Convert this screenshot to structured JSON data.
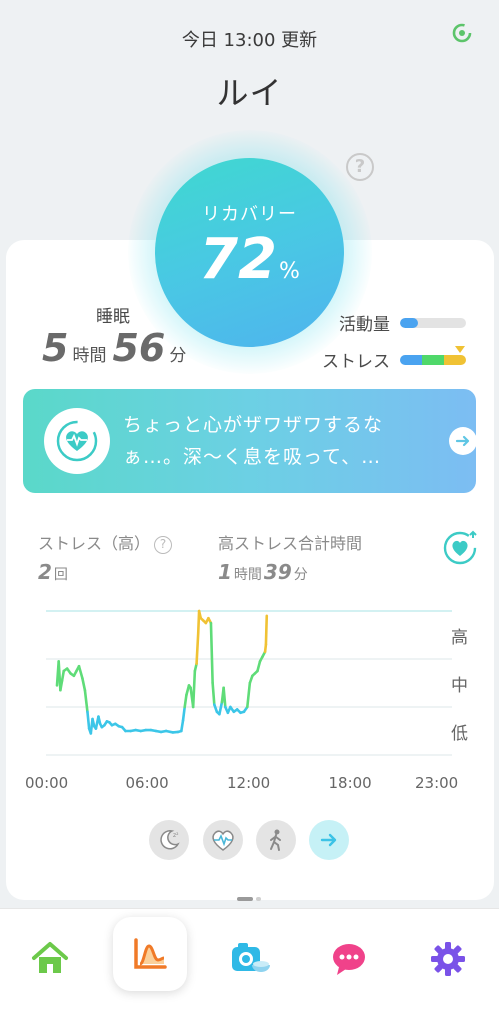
{
  "header": {
    "update_text": "今日 13:00 更新",
    "user_name": "ルイ"
  },
  "recovery": {
    "label": "リカバリー",
    "value": "72",
    "unit": "%"
  },
  "sleep": {
    "label": "睡眠",
    "hours": "5",
    "hours_unit": "時間",
    "minutes": "56",
    "minutes_unit": "分"
  },
  "activity": {
    "label": "活動量",
    "level": 0.28,
    "color": "#4aa3f0"
  },
  "stress_meter": {
    "label": "ストレス",
    "segments": [
      {
        "color": "#4aa3f0",
        "share": 0.33
      },
      {
        "color": "#4fd86a",
        "share": 0.33
      },
      {
        "color": "#f0c234",
        "share": 0.34
      }
    ],
    "marker_color": "#f0c234"
  },
  "message": {
    "text": "ちょっと心がザワザワするなぁ…。深〜く息を吸って、…"
  },
  "stress_stats": {
    "high_label": "ストレス（高）",
    "high_count": "2",
    "high_count_unit": "回",
    "total_label": "高ストレス合計時間",
    "total_hours": "1",
    "total_hours_unit": "時間",
    "total_minutes": "39",
    "total_minutes_unit": "分"
  },
  "chart_data": {
    "type": "line",
    "x_ticks": [
      "00:00",
      "06:00",
      "12:00",
      "18:00",
      "23:00"
    ],
    "y_levels": [
      "低",
      "中",
      "高"
    ],
    "xlim": [
      0,
      24
    ],
    "ylim": [
      0,
      3
    ],
    "series": [
      {
        "points": [
          [
            0.65,
            1.45
          ],
          [
            0.75,
            1.95
          ],
          [
            0.85,
            1.35
          ],
          [
            0.95,
            1.55
          ],
          [
            1.05,
            1.75
          ],
          [
            1.25,
            1.8
          ],
          [
            1.45,
            1.7
          ],
          [
            1.65,
            1.65
          ],
          [
            1.8,
            1.75
          ],
          [
            1.95,
            1.85
          ],
          [
            2.15,
            1.6
          ],
          [
            2.3,
            1.35
          ],
          [
            2.45,
            0.9
          ],
          [
            2.55,
            0.55
          ],
          [
            2.65,
            0.45
          ],
          [
            2.75,
            0.75
          ],
          [
            2.85,
            0.6
          ],
          [
            2.95,
            0.55
          ],
          [
            3.1,
            0.8
          ],
          [
            3.2,
            0.65
          ],
          [
            3.3,
            0.58
          ],
          [
            3.45,
            0.62
          ],
          [
            3.6,
            0.7
          ],
          [
            3.75,
            0.68
          ],
          [
            3.9,
            0.62
          ],
          [
            4.1,
            0.65
          ],
          [
            4.3,
            0.6
          ],
          [
            4.5,
            0.58
          ],
          [
            4.7,
            0.5
          ],
          [
            5.0,
            0.5
          ],
          [
            5.3,
            0.52
          ],
          [
            5.6,
            0.5
          ],
          [
            5.9,
            0.52
          ],
          [
            6.2,
            0.52
          ],
          [
            6.5,
            0.5
          ],
          [
            6.8,
            0.48
          ],
          [
            7.1,
            0.5
          ],
          [
            7.5,
            0.47
          ],
          [
            7.8,
            0.48
          ],
          [
            8.0,
            0.5
          ],
          [
            8.1,
            0.72
          ],
          [
            8.2,
            1.0
          ],
          [
            8.3,
            1.25
          ],
          [
            8.45,
            1.45
          ],
          [
            8.55,
            1.4
          ],
          [
            8.7,
            1.0
          ],
          [
            8.8,
            1.75
          ],
          [
            8.9,
            1.9
          ],
          [
            9.0,
            2.55
          ],
          [
            9.05,
            3.0
          ],
          [
            9.15,
            2.85
          ],
          [
            9.3,
            2.8
          ],
          [
            9.45,
            2.75
          ],
          [
            9.6,
            2.85
          ],
          [
            9.75,
            2.75
          ],
          [
            9.85,
            1.5
          ],
          [
            9.95,
            1.05
          ],
          [
            10.1,
            0.9
          ],
          [
            10.25,
            0.85
          ],
          [
            10.4,
            1.1
          ],
          [
            10.5,
            1.4
          ],
          [
            10.6,
            1.0
          ],
          [
            10.75,
            0.88
          ],
          [
            10.9,
            1.0
          ],
          [
            11.1,
            0.9
          ],
          [
            11.3,
            0.95
          ],
          [
            11.5,
            0.88
          ],
          [
            11.7,
            0.9
          ],
          [
            11.9,
            1.0
          ],
          [
            12.05,
            1.5
          ],
          [
            12.2,
            1.65
          ],
          [
            12.35,
            1.7
          ],
          [
            12.5,
            1.75
          ],
          [
            12.65,
            1.95
          ],
          [
            12.8,
            2.05
          ],
          [
            12.95,
            2.15
          ],
          [
            13.0,
            2.3
          ],
          [
            13.05,
            2.9
          ]
        ]
      }
    ],
    "colors": {
      "low": "#3cc6e8",
      "mid": "#5fdc78",
      "high": "#f0c234"
    },
    "grid": true
  },
  "mode_buttons": [
    {
      "name": "sleep-mode-icon",
      "active": false
    },
    {
      "name": "heart-rate-mode-icon",
      "active": false
    },
    {
      "name": "walk-mode-icon",
      "active": false
    },
    {
      "name": "arrow-right-icon",
      "active": true
    }
  ],
  "tabs": [
    {
      "name": "home-icon",
      "color": "#6cc94a"
    },
    {
      "name": "chart-icon",
      "color": "#f07a28",
      "active": true
    },
    {
      "name": "camera-icon",
      "color": "#2fb9e6"
    },
    {
      "name": "chat-icon",
      "color": "#f0428a"
    },
    {
      "name": "gear-icon",
      "color": "#7a52e8"
    }
  ]
}
